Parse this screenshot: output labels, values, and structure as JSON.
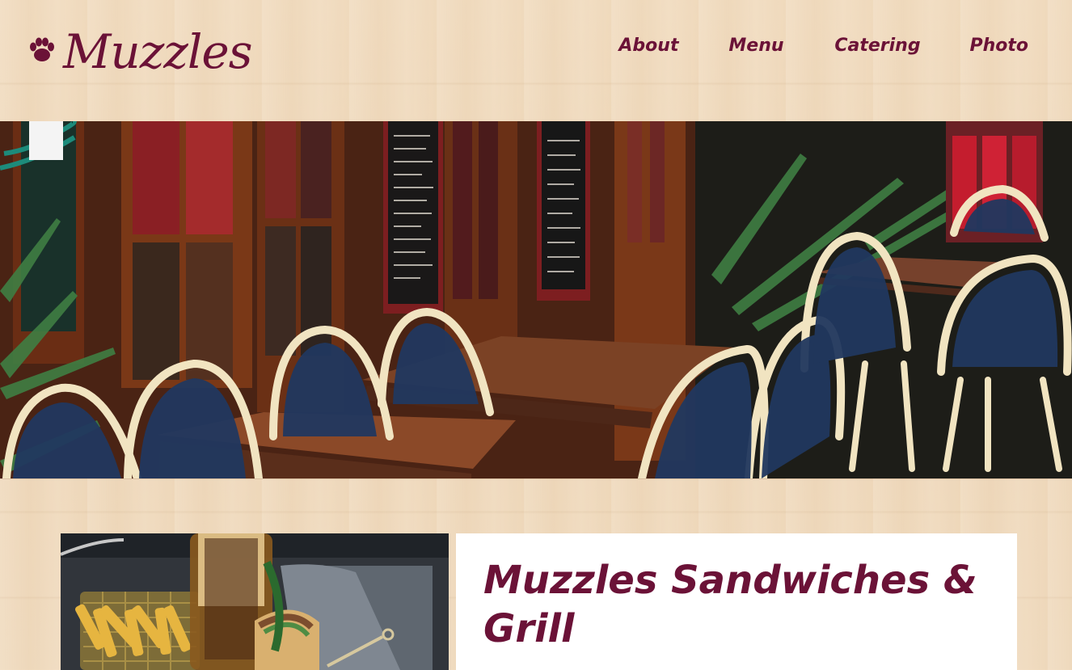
{
  "brand": {
    "name": "Muzzles",
    "logo_icon": "paw-icon",
    "color": "#6b1237"
  },
  "nav": {
    "items": [
      {
        "label": "About"
      },
      {
        "label": "Menu"
      },
      {
        "label": "Catering"
      },
      {
        "label": "Photo"
      }
    ]
  },
  "hero": {
    "image": "outdoor-cafe-terrace-photo"
  },
  "feature": {
    "image": "fries-and-sandwich-photo",
    "title": "Muzzles Sandwiches & Grill"
  }
}
